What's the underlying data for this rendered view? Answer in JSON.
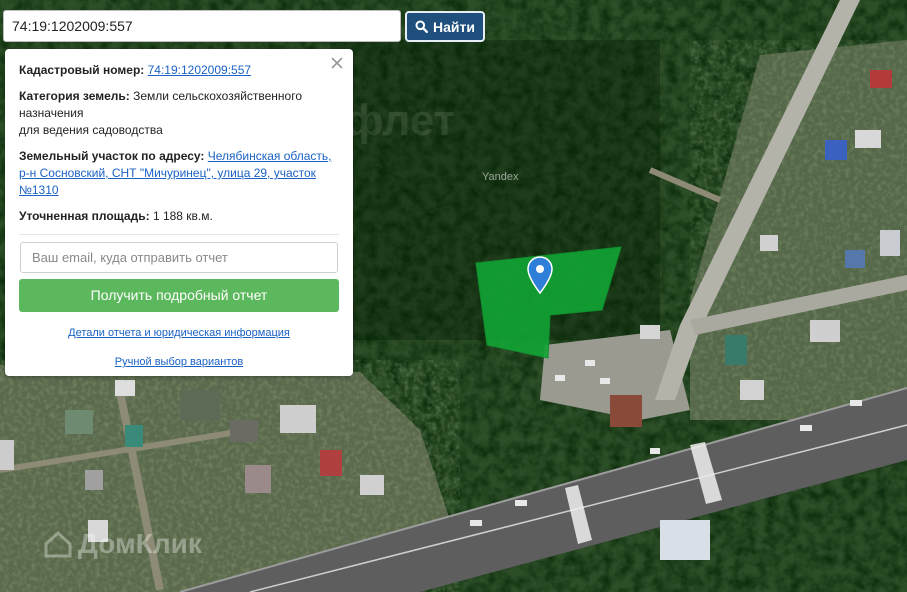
{
  "search": {
    "value": "74:19:1202009:557",
    "button_label": "Найти",
    "icon": "search-icon"
  },
  "panel": {
    "close_icon": "close-icon",
    "cadastral_label": "Кадастровый номер:",
    "cadastral_value": "74:19:1202009:557",
    "category_label": "Категория земель:",
    "category_value": "Земли сельскохозяйственного назначения",
    "category_use": "для ведения садоводства",
    "address_label": "Земельный участок по адресу:",
    "address_value": "Челябинская область, р-н Сосновский, СНТ \"Мичуринец\", улица 29, участок №1310",
    "area_label": "Уточненная площадь:",
    "area_value": "1 188 кв.м.",
    "email_placeholder": "Ваш email, куда отправить отчет",
    "report_button": "Получить подробный отчет",
    "details_link": "Детали отчета и юридическая информация",
    "manual_link": "Ручной выбор вариантов"
  },
  "map": {
    "provider_label": "Yandex",
    "watermark_center": "флет",
    "watermark_logo": "ДомКлик",
    "marker_icon": "map-pin-icon",
    "parcel_color": "#12a535",
    "marker_color": "#2f7fd8"
  }
}
